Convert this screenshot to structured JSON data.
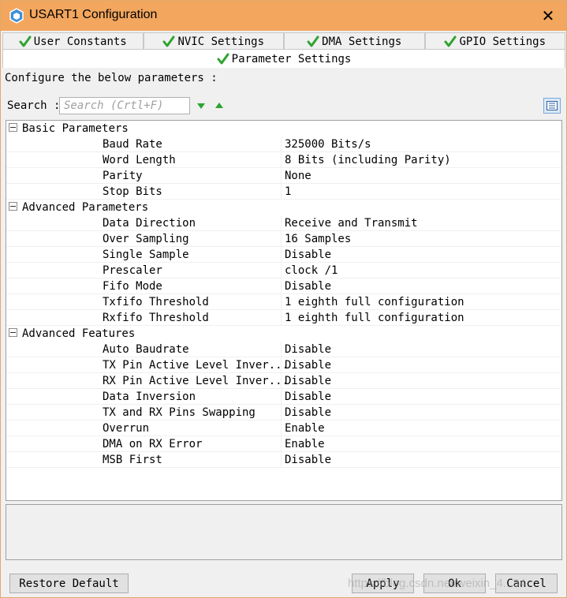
{
  "window": {
    "title": "USART1 Configuration",
    "close_glyph": "✕",
    "titlebar_color": "#f2a65e"
  },
  "tabs_row1": [
    {
      "label": "User Constants"
    },
    {
      "label": "NVIC Settings"
    },
    {
      "label": "DMA Settings"
    },
    {
      "label": "GPIO Settings"
    }
  ],
  "tabs_row2": {
    "label": "Parameter Settings"
  },
  "panel": {
    "configure_label": "Configure the below parameters :",
    "search_label": "Search :",
    "search_placeholder": "Search (Crtl+F)"
  },
  "groups": [
    {
      "name": "Basic Parameters",
      "params": [
        {
          "name": "Baud Rate",
          "value": "325000 Bits/s"
        },
        {
          "name": "Word Length",
          "value": "8 Bits (including Parity)"
        },
        {
          "name": "Parity",
          "value": "None"
        },
        {
          "name": "Stop Bits",
          "value": "1"
        }
      ]
    },
    {
      "name": "Advanced Parameters",
      "params": [
        {
          "name": "Data Direction",
          "value": "Receive and Transmit"
        },
        {
          "name": "Over Sampling",
          "value": "16 Samples"
        },
        {
          "name": "Single Sample",
          "value": "Disable"
        },
        {
          "name": "Prescaler",
          "value": "clock /1"
        },
        {
          "name": "Fifo Mode",
          "value": "Disable"
        },
        {
          "name": "Txfifo Threshold",
          "value": "1 eighth full configuration"
        },
        {
          "name": "Rxfifo Threshold",
          "value": "1 eighth full configuration"
        }
      ]
    },
    {
      "name": "Advanced Features",
      "params": [
        {
          "name": "Auto Baudrate",
          "value": "Disable"
        },
        {
          "name": "TX Pin Active Level Inver...",
          "value": "Disable"
        },
        {
          "name": "RX Pin Active Level Inver...",
          "value": "Disable"
        },
        {
          "name": "Data Inversion",
          "value": "Disable"
        },
        {
          "name": "TX and RX Pins Swapping",
          "value": "Disable"
        },
        {
          "name": "Overrun",
          "value": "Enable"
        },
        {
          "name": "DMA on RX Error",
          "value": "Enable"
        },
        {
          "name": "MSB First",
          "value": "Disable"
        }
      ]
    }
  ],
  "buttons": {
    "restore_default": "Restore Default",
    "apply": "Apply",
    "ok": "Ok",
    "cancel": "Cancel"
  },
  "watermark": "https://blog.csdn.net/weixin_4...34"
}
